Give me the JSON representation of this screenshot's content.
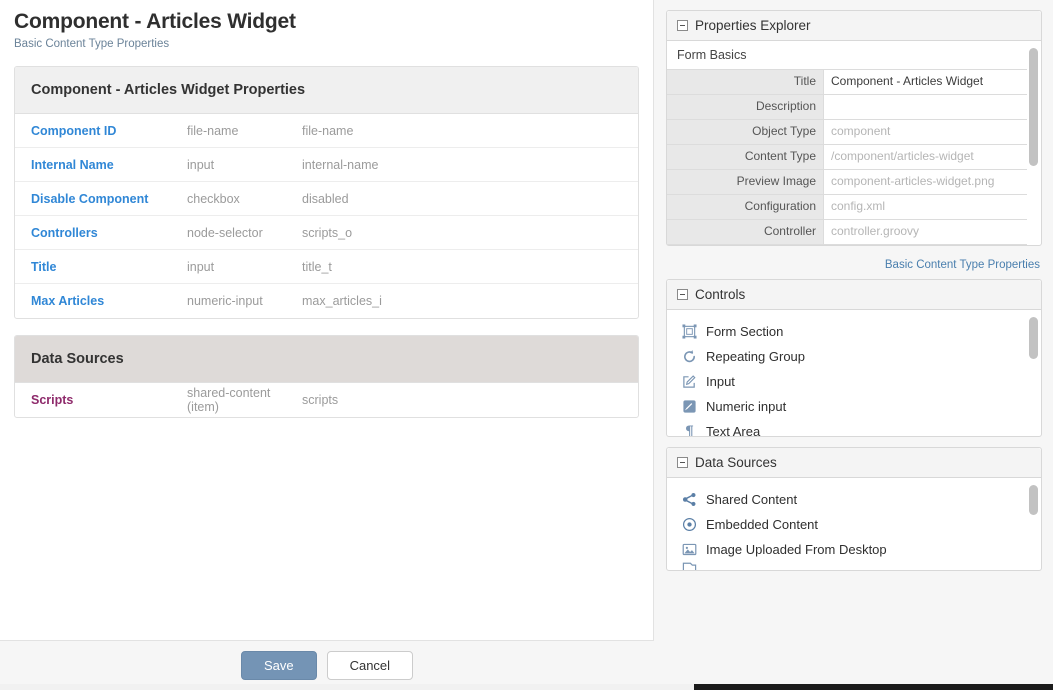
{
  "header": {
    "title": "Component - Articles Widget",
    "subtitle": "Basic Content Type Properties"
  },
  "properties_table": {
    "heading": "Component - Articles Widget Properties",
    "rows": [
      {
        "name": "Component ID",
        "type": "file-name",
        "id": "file-name"
      },
      {
        "name": "Internal Name",
        "type": "input",
        "id": "internal-name"
      },
      {
        "name": "Disable Component",
        "type": "checkbox",
        "id": "disabled"
      },
      {
        "name": "Controllers",
        "type": "node-selector",
        "id": "scripts_o"
      },
      {
        "name": "Title",
        "type": "input",
        "id": "title_t"
      },
      {
        "name": "Max Articles",
        "type": "numeric-input",
        "id": "max_articles_i"
      }
    ]
  },
  "data_sources_table": {
    "heading": "Data Sources",
    "rows": [
      {
        "name": "Scripts",
        "type": "shared-content (item)",
        "id": "scripts"
      }
    ]
  },
  "properties_explorer": {
    "title": "Properties Explorer",
    "section_label": "Form Basics",
    "fields": [
      {
        "label": "Title",
        "value": "Component - Articles Widget",
        "filled": true
      },
      {
        "label": "Description",
        "value": "",
        "filled": true
      },
      {
        "label": "Object Type",
        "value": "component",
        "filled": false
      },
      {
        "label": "Content Type",
        "value": "/component/articles-widget",
        "filled": false
      },
      {
        "label": "Preview Image",
        "value": "component-articles-widget.png",
        "filled": false
      },
      {
        "label": "Configuration",
        "value": "config.xml",
        "filled": false
      },
      {
        "label": "Controller",
        "value": "controller.groovy",
        "filled": false
      }
    ],
    "footer_link": "Basic Content Type Properties"
  },
  "controls_panel": {
    "title": "Controls",
    "items": [
      {
        "label": "Form Section",
        "icon": "form-section-icon"
      },
      {
        "label": "Repeating Group",
        "icon": "repeat-icon"
      },
      {
        "label": "Input",
        "icon": "pencil-square-icon"
      },
      {
        "label": "Numeric input",
        "icon": "pencil-filled-icon"
      },
      {
        "label": "Text Area",
        "icon": "pilcrow-icon"
      }
    ]
  },
  "data_sources_panel": {
    "title": "Data Sources",
    "items": [
      {
        "label": "Shared Content",
        "icon": "share-icon"
      },
      {
        "label": "Embedded Content",
        "icon": "circle-dot-icon"
      },
      {
        "label": "Image Uploaded From Desktop",
        "icon": "image-icon"
      }
    ]
  },
  "footer": {
    "save_label": "Save",
    "cancel_label": "Cancel"
  },
  "colors": {
    "link_blue": "#3087d6",
    "link_purple": "#8e2a6b",
    "save_button": "#7494b5",
    "icon_blue": "#7b96b4"
  }
}
